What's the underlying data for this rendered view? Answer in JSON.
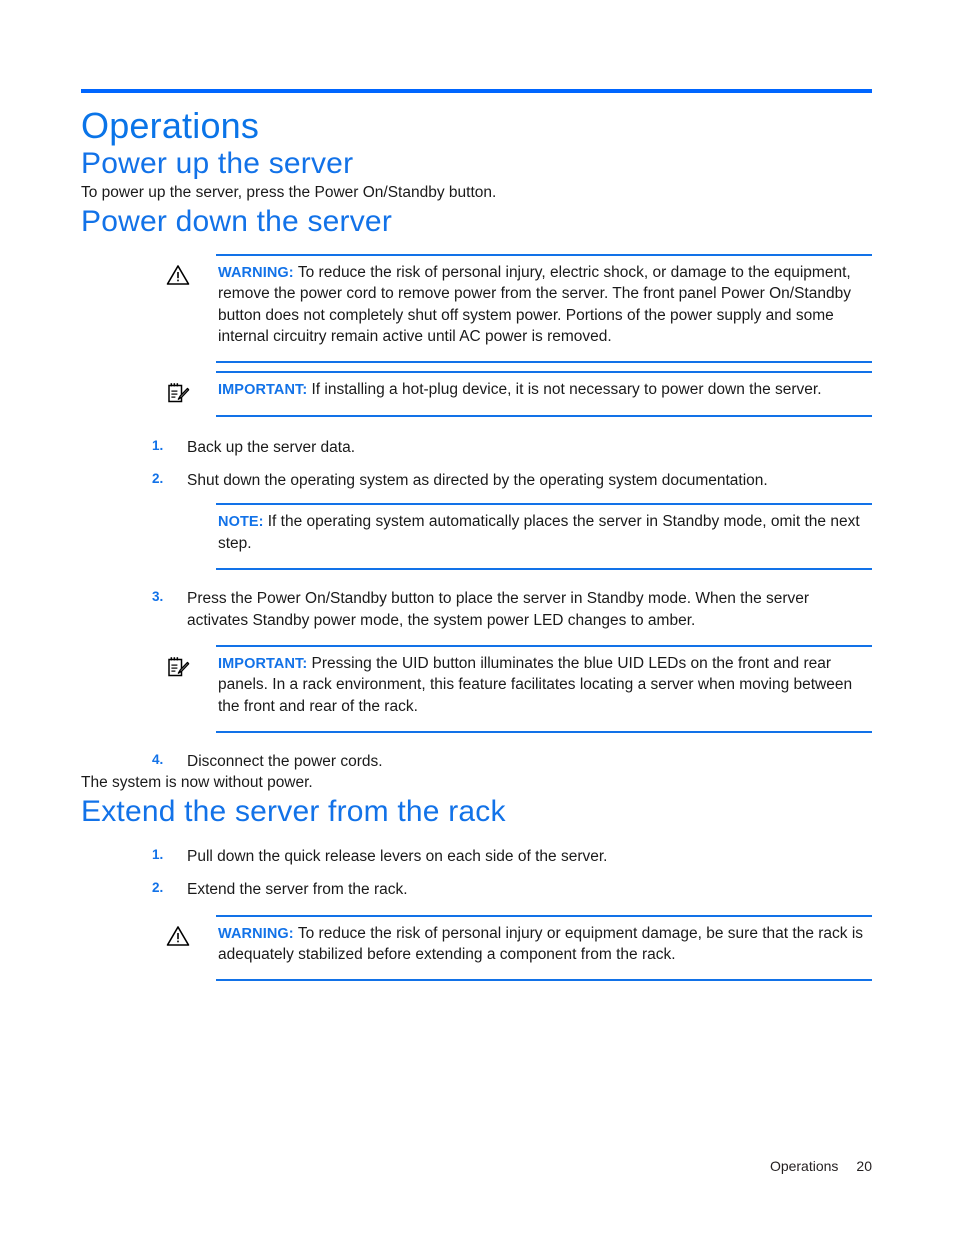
{
  "theme": {
    "accent_blue": "#0066ff",
    "heading_blue": "#1272e8",
    "body_black": "#1a1a1a"
  },
  "chapter": {
    "title": "Operations"
  },
  "sections": [
    {
      "id": "power-up",
      "title": "Power up the server",
      "intro": "To power up the server, press the Power On/Standby button."
    },
    {
      "id": "power-down",
      "title": "Power down the server"
    },
    {
      "id": "extend",
      "title": "Extend the server from the rack"
    }
  ],
  "admonitions": {
    "warning_power_down": {
      "icon": "warning-triangle-icon",
      "label": "WARNING:",
      "text": "To reduce the risk of personal injury, electric shock, or damage to the equipment, remove the power cord to remove power from the server. The front panel Power On/Standby button does not completely shut off system power. Portions of the power supply and some internal circuitry remain active until AC power is removed."
    },
    "important_hotplug": {
      "icon": "important-notepad-icon",
      "label": "IMPORTANT:",
      "text": "If installing a hot-plug device, it is not necessary to power down the server."
    },
    "note_standby": {
      "icon": "",
      "label": "NOTE:",
      "text": "If the operating system automatically places the server in Standby mode, omit the next step."
    },
    "important_uid": {
      "icon": "important-notepad-icon",
      "label": "IMPORTANT:",
      "text": "Pressing the UID button illuminates the blue UID LEDs on the front and rear panels. In a rack environment, this feature facilitates locating a server when moving between the front and rear of the rack."
    },
    "warning_rack": {
      "icon": "warning-triangle-icon",
      "label": "WARNING:",
      "text": "To reduce the risk of personal injury or equipment damage, be sure that the rack is adequately stabilized before extending a component from the rack."
    }
  },
  "power_down_steps": {
    "step1": {
      "num": "1.",
      "text": "Back up the server data."
    },
    "step2": {
      "num": "2.",
      "text": "Shut down the operating system as directed by the operating system documentation."
    },
    "step3": {
      "num": "3.",
      "text": "Press the Power On/Standby button to place the server in Standby mode. When the server activates Standby power mode, the system power LED changes to amber."
    },
    "step4": {
      "num": "4.",
      "text": "Disconnect the power cords."
    }
  },
  "power_down_closing": "The system is now without power.",
  "extend_steps": {
    "step1": {
      "num": "1.",
      "text": "Pull down the quick release levers on each side of the server."
    },
    "step2": {
      "num": "2.",
      "text": "Extend the server from the rack."
    }
  },
  "footer": {
    "label": "Operations",
    "page_number": "20"
  }
}
